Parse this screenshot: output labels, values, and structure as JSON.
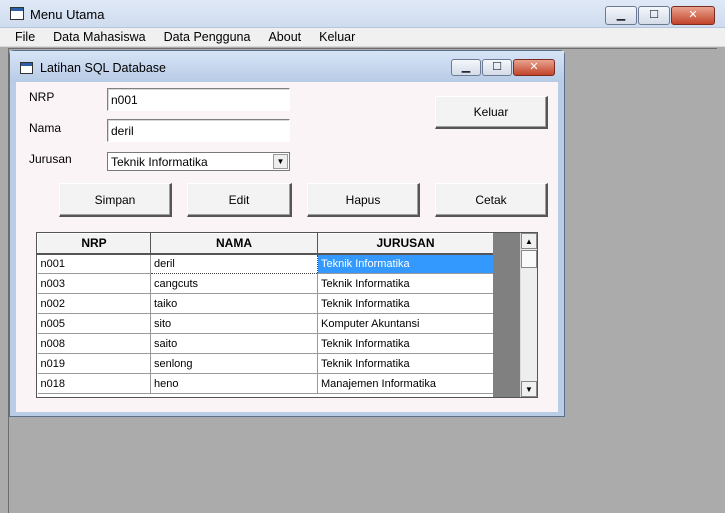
{
  "main_window": {
    "title": "Menu Utama",
    "menu": [
      "File",
      "Data Mahasiswa",
      "Data Pengguna",
      "About",
      "Keluar"
    ],
    "caption": {
      "minimize": "▁",
      "maximize": "☐",
      "close": "✕"
    }
  },
  "form": {
    "title": "Latihan SQL Database",
    "caption": {
      "minimize": "▁",
      "maximize": "☐",
      "close": "✕"
    },
    "labels": {
      "nrp": "NRP",
      "nama": "Nama",
      "jurusan": "Jurusan"
    },
    "fields": {
      "nrp": "n001",
      "nama": "deril",
      "jurusan": "Teknik Informatika"
    },
    "buttons": {
      "keluar": "Keluar",
      "simpan": "Simpan",
      "edit": "Edit",
      "hapus": "Hapus",
      "cetak": "Cetak"
    }
  },
  "grid": {
    "columns": [
      "NRP",
      "NAMA",
      "JURUSAN"
    ],
    "rows": [
      [
        "n001",
        "deril",
        "Teknik Informatika"
      ],
      [
        "n003",
        "cangcuts",
        "Teknik Informatika"
      ],
      [
        "n002",
        "taiko",
        "Teknik Informatika"
      ],
      [
        "n005",
        "sito",
        "Komputer Akuntansi"
      ],
      [
        "n008",
        "saito",
        "Teknik Informatika"
      ],
      [
        "n019",
        "senlong",
        "Teknik Informatika"
      ],
      [
        "n018",
        "heno",
        "Manajemen Informatika"
      ]
    ],
    "selected_color": "#3399ff"
  }
}
